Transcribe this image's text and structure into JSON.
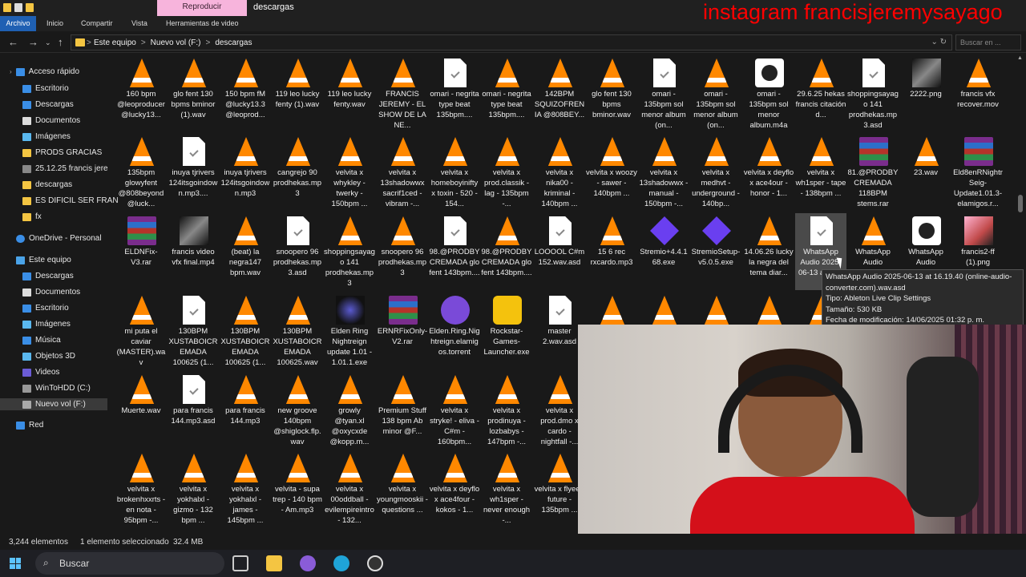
{
  "window": {
    "title": "descargas"
  },
  "ribbon": {
    "tabs": [
      "Archivo",
      "Inicio",
      "Compartir",
      "Vista",
      "Herramientas de video"
    ],
    "contextual_tab": "Reproducir"
  },
  "overlay": {
    "text": "instagram francisjeremysayago",
    "color": "#ff0000"
  },
  "address": {
    "crumbs": [
      "Este equipo",
      "Nuevo vol (F:)",
      "descargas"
    ],
    "separator": ">",
    "search_placeholder": "Buscar en ..."
  },
  "nav": {
    "quick_access": "Acceso rápido",
    "quick_items": [
      "Escritorio",
      "Descargas",
      "Documentos",
      "Imágenes",
      "PRODS GRACIAS",
      "25.12.25 francis jere",
      "descargas",
      "ES DIFICIL SER FRAN",
      "fx"
    ],
    "onedrive": "OneDrive - Personal",
    "this_pc": "Este equipo",
    "pc_items": [
      "Descargas",
      "Documentos",
      "Escritorio",
      "Imágenes",
      "Música",
      "Objetos 3D",
      "Videos",
      "WinToHDD (C:)",
      "Nuevo vol (F:)"
    ],
    "network": "Red"
  },
  "files": [
    [
      "vlc",
      "160 bpm @leoproducer @lucky13..."
    ],
    [
      "vlc",
      "glo fent 130 bpms bminor (1).wav"
    ],
    [
      "vlc",
      "150 bpm fM @lucky13.3 @leoprod..."
    ],
    [
      "vlc",
      "119 leo lucky fenty (1).wav"
    ],
    [
      "vlc",
      "119 leo lucky fenty.wav"
    ],
    [
      "vlc",
      "FRANCIS JEREMY - EL SHOW DE LA NE..."
    ],
    [
      "doc",
      "omari - negrita type beat 135bpm...."
    ],
    [
      "vlc",
      "omari - negrita type beat 135bpm...."
    ],
    [
      "vlc",
      "142BPM SQUIZOFRENIA @808BEY..."
    ],
    [
      "vlc",
      "glo fent 130 bpms bminor.wav"
    ],
    [
      "doc",
      "omari - 135bpm sol menor album (on..."
    ],
    [
      "vlc",
      "omari - 135bpm sol menor album (on..."
    ],
    [
      "m4a",
      "omari - 135bpm sol menor album.m4a"
    ],
    [
      "vlc",
      "29.6.25 hekas francis citación d..."
    ],
    [
      "doc",
      "shoppingsayago 141 prodhekas.mp3.asd"
    ],
    [
      "img",
      "2222.png"
    ],
    [
      "vlc",
      "francis vfx recover.mov"
    ],
    [
      "vlc",
      "135bpm glowyfent @808beyond @luck..."
    ],
    [
      "doc",
      "inuya tjrivers 124itsgoindown.mp3...."
    ],
    [
      "vlc",
      "inuya tjrivers 124itsgoindown.mp3"
    ],
    [
      "vlc",
      "cangrejo 90 prodhekas.mp3"
    ],
    [
      "vlc",
      "velvita x whykley - twerky - 150bpm ..."
    ],
    [
      "vlc",
      "velvita x 13shadowwx sacrif1ced - vibram -..."
    ],
    [
      "vlc",
      "velvita x homeboyinifty x toxin - 520 - 154..."
    ],
    [
      "vlc",
      "velvita x prod.classik - lag - 135bpm -..."
    ],
    [
      "vlc",
      "velvita x nika00 - kriminal - 140bpm ..."
    ],
    [
      "vlc",
      "velvita x woozy - sawer - 140bpm ..."
    ],
    [
      "vlc",
      "velvita x 13shadowwx - manual - 150bpm -..."
    ],
    [
      "vlc",
      "velvita x medhvt - underground - 140bp..."
    ],
    [
      "vlc",
      "velvita x deyflo x ace4our - honor - 1..."
    ],
    [
      "vlc",
      "velvita x wh1sper - tape - 138bpm ..."
    ],
    [
      "rar",
      "81.@PRODBYCREMADA 118BPM stems.rar"
    ],
    [
      "vlc",
      "23.wav"
    ],
    [
      "rar",
      "Eld8enRNightrSeig-Update1.01.3-elamigos.r..."
    ],
    [
      "rar",
      "ELDNFix-V3.rar"
    ],
    [
      "img",
      "francis video vfx final.mp4"
    ],
    [
      "vlc",
      "(beat) la negra147 bpm.wav"
    ],
    [
      "doc",
      "snoopero 96 prodhekas.mp3.asd"
    ],
    [
      "vlc",
      "shoppingsayago 141 prodhekas.mp3"
    ],
    [
      "vlc",
      "snoopero 96 prodhekas.mp3"
    ],
    [
      "doc",
      "98.@PRODBYCREMADA glo fent 143bpm...."
    ],
    [
      "vlc",
      "98.@PRODBYCREMADA glo fent 143bpm...."
    ],
    [
      "doc",
      "LOOOOL C#m 152.wav.asd"
    ],
    [
      "vlc",
      "15 6 rec rxcardo.mp3"
    ],
    [
      "stremio",
      "Stremio+4.4.168.exe"
    ],
    [
      "stremio",
      "StremioSetup-v5.0.5.exe"
    ],
    [
      "vlc",
      "14.06.26 lucky la negra del tema diar..."
    ],
    [
      "doc",
      "WhatsApp Audio 2025-06-13 at 16..."
    ],
    [
      "vlc",
      "WhatsApp Audio"
    ],
    [
      "m4a",
      "WhatsApp Audio"
    ],
    [
      "img2",
      "francis2-ff (1).png"
    ],
    [
      "vlc",
      "mi puta el caviar (MASTER).wav"
    ],
    [
      "doc",
      "130BPM XUSTABOICREMADA 100625 (1..."
    ],
    [
      "vlc",
      "130BPM XUSTABOICREMADA 100625 (1..."
    ],
    [
      "vlc",
      "130BPM XUSTABOICREMADA 100625.wav"
    ],
    [
      "elden",
      "Elden Ring Nightreign update 1.01 - 1.01.1.exe"
    ],
    [
      "rar",
      "ERNRFixOnly-V2.rar"
    ],
    [
      "eldenb",
      "Elden.Ring.Nightreign.elamigos.torrent"
    ],
    [
      "rock",
      "Rockstar-Games-Launcher.exe"
    ],
    [
      "doc",
      "master 2.wav.asd"
    ],
    [
      "vlc",
      ""
    ],
    [
      "vlc",
      ""
    ],
    [
      "vlc",
      ""
    ],
    [
      "vlc",
      ""
    ],
    [
      "vlc",
      ""
    ],
    [
      "vlc",
      ""
    ],
    [
      "vlc",
      ""
    ],
    [
      "vlc",
      ""
    ],
    [
      "vlc",
      "Muerte.wav"
    ],
    [
      "doc",
      "para francis 144.mp3.asd"
    ],
    [
      "vlc",
      "para francis 144.mp3"
    ],
    [
      "vlc",
      "new groove 140bpm @shiglock.flp.wav"
    ],
    [
      "vlc",
      "growly @tyan.xl @oxycxde @kopp.m..."
    ],
    [
      "vlc",
      "Premium Stuff 138 bpm Ab minor @F..."
    ],
    [
      "vlc",
      "velvita x stryke! - eliva - C#m - 160bpm..."
    ],
    [
      "vlc",
      "velvita x prodinuya - lozbabys - 147bpm -..."
    ],
    [
      "vlc",
      "velvita x prod.dmo x cardo - nightfall -..."
    ],
    [
      "vlc",
      "velvita x brokenhxxrts - en nota - 95bpm -..."
    ],
    [
      "vlc",
      "velvita x yokhalxl - gizmo - 132 bpm ..."
    ],
    [
      "vlc",
      "velvita x yokhalxl - james - 145bpm ..."
    ],
    [
      "vlc",
      "velvita - supa trep - 140 bpm - Am.mp3"
    ],
    [
      "vlc",
      "velvita x 00oddball - evilempireintro - 132..."
    ],
    [
      "vlc",
      "velvita x youngmooskii - questions ..."
    ],
    [
      "vlc",
      "velvita x deyflo x ace4four - kokos - 1..."
    ],
    [
      "vlc",
      "velvita x wh1sper - never enough -..."
    ],
    [
      "vlc",
      "velvita x flyee - future - 135bpm ..."
    ]
  ],
  "tooltip": {
    "name": "WhatsApp Audio 2025-06-13 at 16.19.40 (online-audio-converter.com).wav.asd",
    "type": "Tipo: Ableton Live Clip Settings",
    "size": "Tamaño: 530 KB",
    "date": "Fecha de modificación: 14/06/2025 01:32 p. m."
  },
  "status": {
    "count": "3,244 elementos",
    "selected": "1 elemento seleccionado",
    "size": "32.4 MB"
  },
  "taskbar": {
    "search": "Buscar"
  },
  "colors": {
    "accent": "#1f60b3",
    "vlc": "#ff8800",
    "contextual_tab": "#f7b4dc"
  }
}
